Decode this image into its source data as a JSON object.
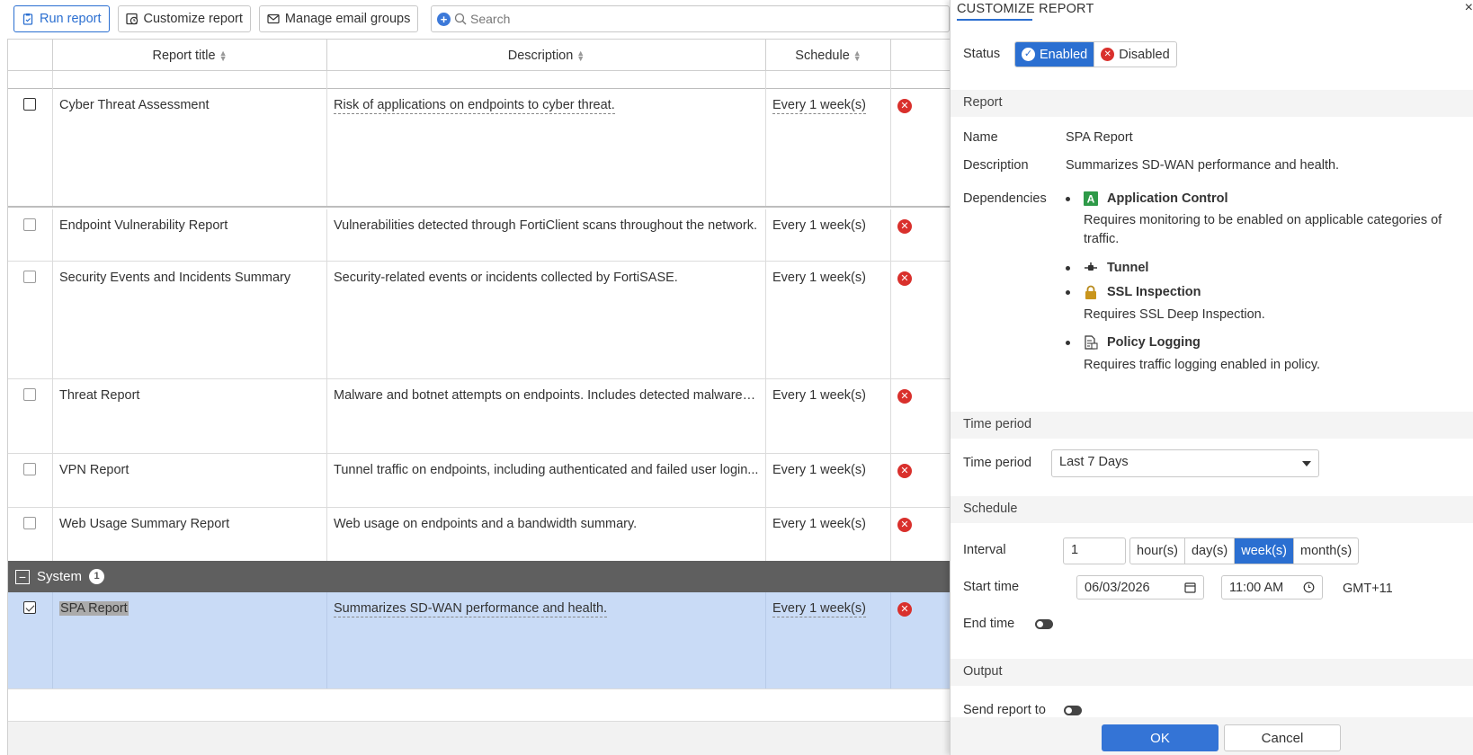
{
  "toolbar": {
    "run_label": "Run report",
    "customize_label": "Customize report",
    "email_label": "Manage email groups",
    "search_placeholder": "Search"
  },
  "table": {
    "headers": [
      "Report title",
      "Description",
      "Schedule"
    ],
    "rows": [
      {
        "title": "Cyber Threat Assessment",
        "description": "Risk of applications on endpoints to cyber threat.",
        "schedule": "Every 1 week(s)"
      },
      {
        "title": "Endpoint Vulnerability Report",
        "description": "Vulnerabilities detected through FortiClient scans throughout the network.",
        "schedule": "Every 1 week(s)"
      },
      {
        "title": "Security Events and Incidents Summary",
        "description": "Security-related events or incidents collected by FortiSASE.",
        "schedule": "Every 1 week(s)"
      },
      {
        "title": "Threat Report",
        "description": "Malware and botnet attempts on endpoints. Includes detected malware a...",
        "schedule": "Every 1 week(s)"
      },
      {
        "title": "VPN Report",
        "description": "Tunnel traffic on endpoints, including authenticated and failed user login...",
        "schedule": "Every 1 week(s)"
      },
      {
        "title": "Web Usage Summary Report",
        "description": "Web usage on endpoints and a bandwidth summary.",
        "schedule": "Every 1 week(s)"
      }
    ],
    "group": {
      "name": "System",
      "count": "1"
    },
    "selected_row": {
      "title": "SPA Report",
      "description": "Summarizes SD-WAN performance and health.",
      "schedule": "Every 1 week(s)"
    }
  },
  "panel": {
    "title": "CUSTOMIZE REPORT",
    "close": "×",
    "status_label": "Status",
    "status_enabled": "Enabled",
    "status_disabled": "Disabled",
    "section_report": "Report",
    "name_label": "Name",
    "name_value": "SPA Report",
    "description_label": "Description",
    "description_value": "Summarizes SD-WAN performance and health.",
    "dependencies_label": "Dependencies",
    "dependencies": [
      {
        "name": "Application Control",
        "note": "Requires monitoring to be enabled on applicable categories of traffic."
      },
      {
        "name": "Tunnel",
        "note": ""
      },
      {
        "name": "SSL Inspection",
        "note": "Requires SSL Deep Inspection."
      },
      {
        "name": "Policy Logging",
        "note": "Requires traffic logging enabled in policy."
      }
    ],
    "app_icon_letter": "A",
    "section_time": "Time period",
    "time_label": "Time period",
    "time_value": "Last 7 Days",
    "section_schedule": "Schedule",
    "interval_label": "Interval",
    "interval_value": "1",
    "interval_units": [
      "hour(s)",
      "day(s)",
      "week(s)",
      "month(s)"
    ],
    "start_label": "Start time",
    "start_date": "06/03/2026",
    "start_time": "11:00  AM",
    "timezone": "GMT+11",
    "end_label": "End time",
    "section_output": "Output",
    "send_label": "Send report to",
    "ok_label": "OK",
    "cancel_label": "Cancel"
  },
  "colors": {
    "accent": "#2b6fd1",
    "error": "#d9302c",
    "group_bar": "#5f5f5f",
    "selected_row": "#c9dbf6"
  }
}
